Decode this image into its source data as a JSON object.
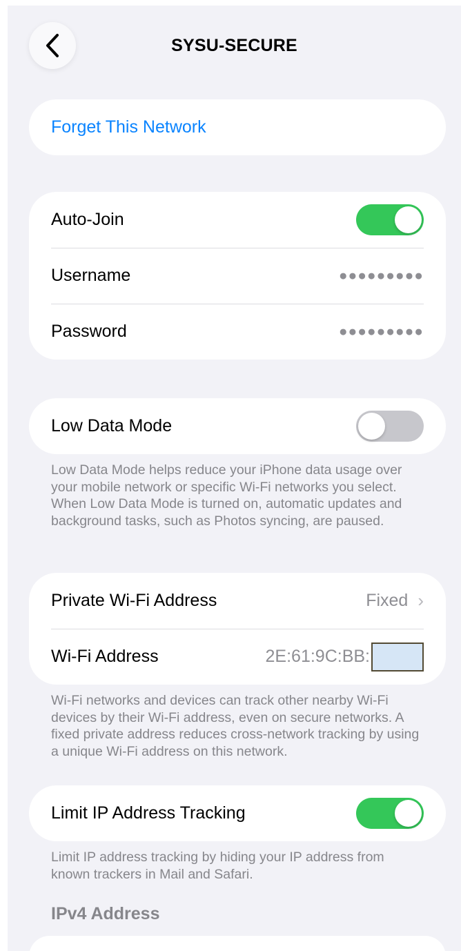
{
  "nav": {
    "title": "SYSU-SECURE",
    "back_icon": "chevron-left-icon"
  },
  "forget": {
    "label": "Forget This Network",
    "color": "#0a84ff"
  },
  "credentials": {
    "auto_join": {
      "label": "Auto-Join",
      "state": "on"
    },
    "username": {
      "label": "Username",
      "value": "●●●●●●●●●"
    },
    "password": {
      "label": "Password",
      "value": "●●●●●●●●●"
    }
  },
  "low_data": {
    "label": "Low Data Mode",
    "state": "off",
    "footnote": "Low Data Mode helps reduce your iPhone data usage over your mobile network or specific Wi-Fi networks you select. When Low Data Mode is turned on, automatic updates and background tasks, such as Photos syncing, are paused."
  },
  "private_address": {
    "label": "Private Wi-Fi Address",
    "value": "Fixed",
    "chevron": "›",
    "wifi_label": "Wi-Fi Address",
    "wifi_value": "2E:61:9C:BB:",
    "footnote": "Wi-Fi networks and devices can track other nearby Wi-Fi devices by their Wi-Fi address, even on secure networks. A fixed private address reduces cross-network tracking by using a unique Wi-Fi address on this network."
  },
  "limit_ip": {
    "label": "Limit IP Address Tracking",
    "state": "on",
    "footnote": "Limit IP address tracking by hiding your IP address from known trackers in Mail and Safari."
  },
  "ipv4": {
    "header": "IPv4 Address"
  },
  "colors": {
    "accent": "#0a84ff",
    "toggle_on": "#34c759",
    "toggle_off": "#c7c7cc",
    "background": "#f2f2f7"
  }
}
